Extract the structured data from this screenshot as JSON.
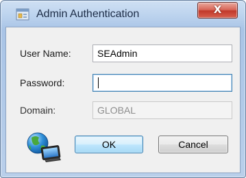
{
  "window": {
    "title": "Admin Authentication",
    "close_label": "X"
  },
  "form": {
    "username_label": "User Name:",
    "username_value": "SEAdmin",
    "password_label": "Password:",
    "password_value": "",
    "domain_label": "Domain:",
    "domain_value": "GLOBAL"
  },
  "buttons": {
    "ok_label": "OK",
    "cancel_label": "Cancel"
  },
  "icons": {
    "title_icon": "app-window-icon",
    "network_icon": "globe-computer-network-icon"
  },
  "colors": {
    "focus_border": "#3c7fb1",
    "close_button": "#c0392b",
    "titlebar": "#bcd3ee"
  }
}
